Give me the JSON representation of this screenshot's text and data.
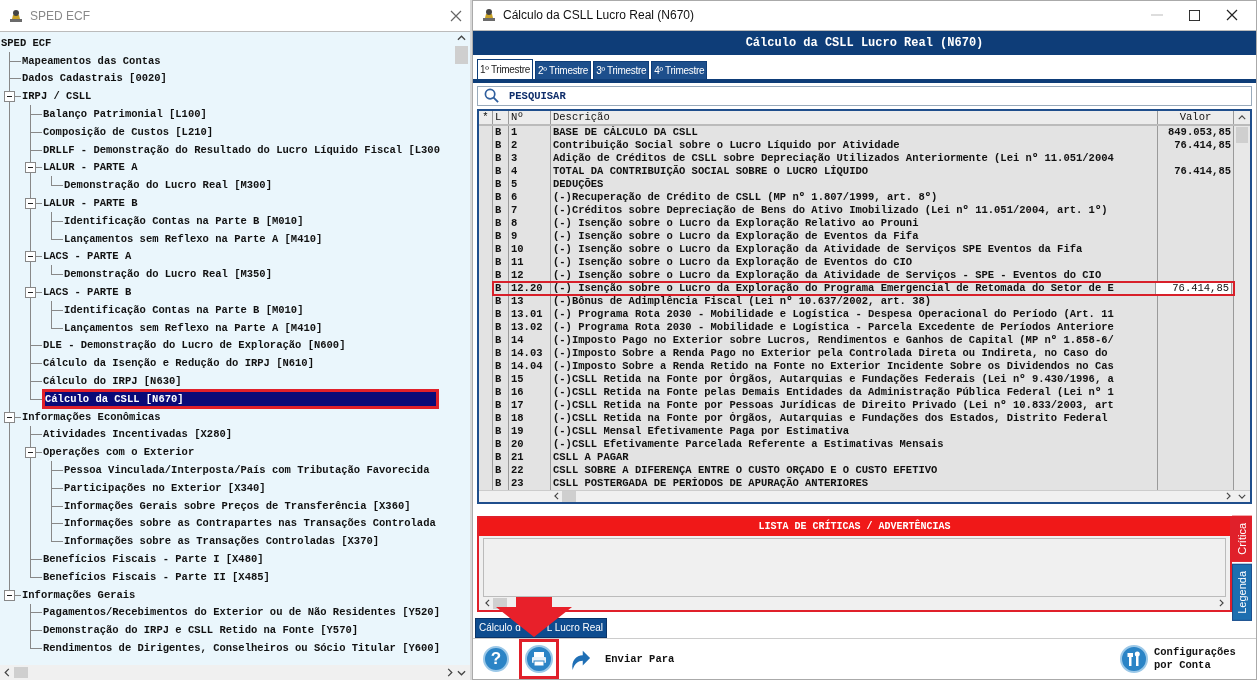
{
  "left_window": {
    "title": "SPED ECF",
    "tree": [
      {
        "label": "SPED ECF",
        "selected": false,
        "children": [
          {
            "label": "Mapeamentos das Contas",
            "selected": false
          },
          {
            "label": "Dados Cadastrais [0020]",
            "selected": false
          },
          {
            "label": "IRPJ / CSLL",
            "selected": false,
            "expanded": true,
            "children": [
              {
                "label": "Balanço Patrimonial [L100]",
                "selected": false
              },
              {
                "label": "Composição de Custos [L210]",
                "selected": false
              },
              {
                "label": "DRLLF - Demonstração do Resultado do Lucro Líquido Fiscal [L300",
                "selected": false
              },
              {
                "label": "LALUR - PARTE A",
                "selected": false,
                "expanded": true,
                "children": [
                  {
                    "label": "Demonstração do Lucro Real [M300]",
                    "selected": false
                  }
                ]
              },
              {
                "label": "LALUR - PARTE B",
                "selected": false,
                "expanded": true,
                "children": [
                  {
                    "label": "Identificação Contas na Parte B [M010]",
                    "selected": false
                  },
                  {
                    "label": "Lançamentos sem Reflexo na Parte A [M410]",
                    "selected": false
                  }
                ]
              },
              {
                "label": "LACS - PARTE A",
                "selected": false,
                "expanded": true,
                "children": [
                  {
                    "label": "Demonstração do Lucro Real [M350]",
                    "selected": false
                  }
                ]
              },
              {
                "label": "LACS - PARTE B",
                "selected": false,
                "expanded": true,
                "children": [
                  {
                    "label": "Identificação Contas na Parte B [M010]",
                    "selected": false
                  },
                  {
                    "label": "Lançamentos sem Reflexo na Parte A [M410]",
                    "selected": false
                  }
                ]
              },
              {
                "label": "DLE - Demonstração do Lucro de Exploração [N600]",
                "selected": false
              },
              {
                "label": "Cálculo da Isenção e Redução do IRPJ [N610]",
                "selected": false
              },
              {
                "label": "Cálculo do IRPJ [N630]",
                "selected": false
              },
              {
                "label": "Cálculo da CSLL [N670]",
                "selected": true
              }
            ]
          },
          {
            "label": "Informações Econômicas",
            "selected": false,
            "expanded": true,
            "children": [
              {
                "label": "Atividades Incentivadas [X280]",
                "selected": false
              },
              {
                "label": "Operações com o Exterior",
                "selected": false,
                "expanded": true,
                "children": [
                  {
                    "label": "Pessoa Vinculada/Interposta/País com Tributação Favorecida",
                    "selected": false
                  },
                  {
                    "label": "Participações no Exterior [X340]",
                    "selected": false
                  },
                  {
                    "label": "Informações Gerais sobre Preços de Transferência [X360]",
                    "selected": false
                  },
                  {
                    "label": "Informações sobre as Contrapartes nas Transações Controlada",
                    "selected": false
                  },
                  {
                    "label": "Informações sobre as Transações Controladas [X370]",
                    "selected": false
                  }
                ]
              },
              {
                "label": "Benefícios Fiscais - Parte I [X480]",
                "selected": false
              },
              {
                "label": "Benefícios Fiscais - Parte II [X485]",
                "selected": false
              }
            ]
          },
          {
            "label": "Informações Gerais",
            "selected": false,
            "expanded": true,
            "children": [
              {
                "label": "Pagamentos/Recebimentos do Exterior ou de Não Residentes [Y520]",
                "selected": false
              },
              {
                "label": "Demonstração do IRPJ e CSLL Retido na Fonte [Y570]",
                "selected": false
              },
              {
                "label": "Rendimentos de Dirigentes, Conselheiros ou Sócio Titular [Y600]",
                "selected": false
              }
            ]
          }
        ]
      }
    ]
  },
  "right_window": {
    "title": "Cálculo da CSLL Lucro Real (N670)",
    "header": "Cálculo da CSLL Lucro Real (N670)",
    "tabs": [
      {
        "label": "1º Trimestre",
        "selected": true
      },
      {
        "label": "2º Trimestre",
        "selected": false
      },
      {
        "label": "3º Trimestre",
        "selected": false
      },
      {
        "label": "4º Trimestre",
        "selected": false
      }
    ],
    "search": {
      "placeholder": "PESQUISAR"
    },
    "table": {
      "columns": [
        "*",
        "L",
        "Nº",
        "Descrição",
        "Valor"
      ],
      "rows": [
        {
          "l": "B",
          "n": "1",
          "description": "BASE DE CÁLCULO DA CSLL",
          "value": "849.053,85",
          "selected": false
        },
        {
          "l": "B",
          "n": "2",
          "description": "Contribuição Social sobre o Lucro Líquido por Atividade",
          "value": "76.414,85",
          "selected": false
        },
        {
          "l": "B",
          "n": "3",
          "description": "Adição de Créditos de CSLL sobre Depreciação Utilizados Anteriormente (Lei nº 11.051/2004",
          "selected": false
        },
        {
          "l": "B",
          "n": "4",
          "description": "TOTAL DA CONTRIBUIÇÃO SOCIAL SOBRE O LUCRO LÍQUIDO",
          "value": "76.414,85",
          "selected": false
        },
        {
          "l": "B",
          "n": "5",
          "description": "DEDUÇÕES",
          "selected": false
        },
        {
          "l": "B",
          "n": "6",
          "description": "(-)Recuperação de Crédito de CSLL (MP nº 1.807/1999, art. 8º)",
          "selected": false
        },
        {
          "l": "B",
          "n": "7",
          "description": "(-)Créditos sobre Depreciação de Bens do Ativo Imobilizado (Lei nº 11.051/2004, art. 1º)",
          "selected": false
        },
        {
          "l": "B",
          "n": "8",
          "description": "(-) Isenção sobre o Lucro da Exploração Relativo ao Prouni",
          "selected": false
        },
        {
          "l": "B",
          "n": "9",
          "description": "(-) Isenção sobre o Lucro da Exploração de Eventos da Fifa",
          "selected": false
        },
        {
          "l": "B",
          "n": "10",
          "description": "(-) Isenção sobre o Lucro da Exploração da Atividade de Serviços SPE Eventos da Fifa",
          "selected": false
        },
        {
          "l": "B",
          "n": "11",
          "description": "(-) Isenção sobre o Lucro da Exploração de Eventos do CIO",
          "selected": false
        },
        {
          "l": "B",
          "n": "12",
          "description": "(-) Isenção sobre o Lucro da Exploração da Atividade de Serviços - SPE - Eventos do CIO",
          "selected": false
        },
        {
          "l": "B",
          "n": "12.20",
          "description": "(-) Isenção sobre o Lucro da Exploração do Programa Emergencial de Retomada do Setor de E",
          "value": "76.414,85",
          "selected": true
        },
        {
          "l": "B",
          "n": "13",
          "description": "(-)Bônus de Adimplência Fiscal (Lei nº 10.637/2002, art. 38)",
          "selected": false
        },
        {
          "l": "B",
          "n": "13.01",
          "description": "(-) Programa Rota 2030 - Mobilidade e Logística - Despesa Operacional do Período (Art. 11",
          "selected": false
        },
        {
          "l": "B",
          "n": "13.02",
          "description": "(-) Programa Rota 2030 - Mobilidade e Logística - Parcela Excedente de Períodos Anteriore",
          "selected": false
        },
        {
          "l": "B",
          "n": "14",
          "description": "(-)Imposto Pago no Exterior sobre Lucros, Rendimentos e Ganhos de Capital (MP nº 1.858-6/",
          "selected": false
        },
        {
          "l": "B",
          "n": "14.03",
          "description": "(-)Imposto Sobre a Renda Pago no Exterior pela Controlada Direta ou Indireta, no Caso do",
          "selected": false
        },
        {
          "l": "B",
          "n": "14.04",
          "description": "(-)Imposto Sobre a Renda Retido na Fonte no Exterior Incidente Sobre os Dividendos no Cas",
          "selected": false
        },
        {
          "l": "B",
          "n": "15",
          "description": "(-)CSLL Retida na Fonte por Órgãos, Autarquias e Fundações Federais (Lei nº 9.430/1996, a",
          "selected": false
        },
        {
          "l": "B",
          "n": "16",
          "description": "(-)CSLL Retida na Fonte pelas Demais Entidades da Administração Pública Federal (Lei nº 1",
          "selected": false
        },
        {
          "l": "B",
          "n": "17",
          "description": "(-)CSLL Retida na Fonte por Pessoas Jurídicas de Direito Privado (Lei nº 10.833/2003, art",
          "selected": false
        },
        {
          "l": "B",
          "n": "18",
          "description": "(-)CSLL Retida na Fonte por Órgãos, Autarquias e Fundações dos Estados, Distrito Federal",
          "selected": false
        },
        {
          "l": "B",
          "n": "19",
          "description": "(-)CSLL Mensal Efetivamente Paga por Estimativa",
          "selected": false
        },
        {
          "l": "B",
          "n": "20",
          "description": "(-)CSLL Efetivamente Parcelada Referente a Estimativas Mensais",
          "selected": false
        },
        {
          "l": "B",
          "n": "21",
          "description": "CSLL A PAGAR",
          "selected": false
        },
        {
          "l": "B",
          "n": "22",
          "description": "CSLL SOBRE A DIFERENÇA ENTRE O CUSTO ORÇADO E O CUSTO EFETIVO",
          "selected": false
        },
        {
          "l": "B",
          "n": "23",
          "description": "CSLL POSTERGADA DE PERÍODOS DE APURAÇÃO ANTERIORES",
          "selected": false
        }
      ]
    },
    "critics": {
      "title": "LISTA DE CRÍTICAS / ADVERTÊNCIAS",
      "side_tabs": [
        {
          "label": "Crítica",
          "selected": true
        },
        {
          "label": "Legenda",
          "selected": false
        }
      ]
    },
    "bottom_tab": {
      "label_start": "Cálculo d",
      "label_end": "L Lucro Real"
    },
    "toolbar": [
      {
        "kind": "help",
        "label": "?",
        "highlighted": false
      },
      {
        "kind": "print",
        "highlighted": true
      },
      {
        "kind": "send",
        "label": "Enviar Para",
        "highlighted": false
      },
      {
        "kind": "settings",
        "label": "Configurações por Conta",
        "highlighted": false
      }
    ],
    "annotations": [
      {
        "kind": "arrow"
      }
    ]
  }
}
